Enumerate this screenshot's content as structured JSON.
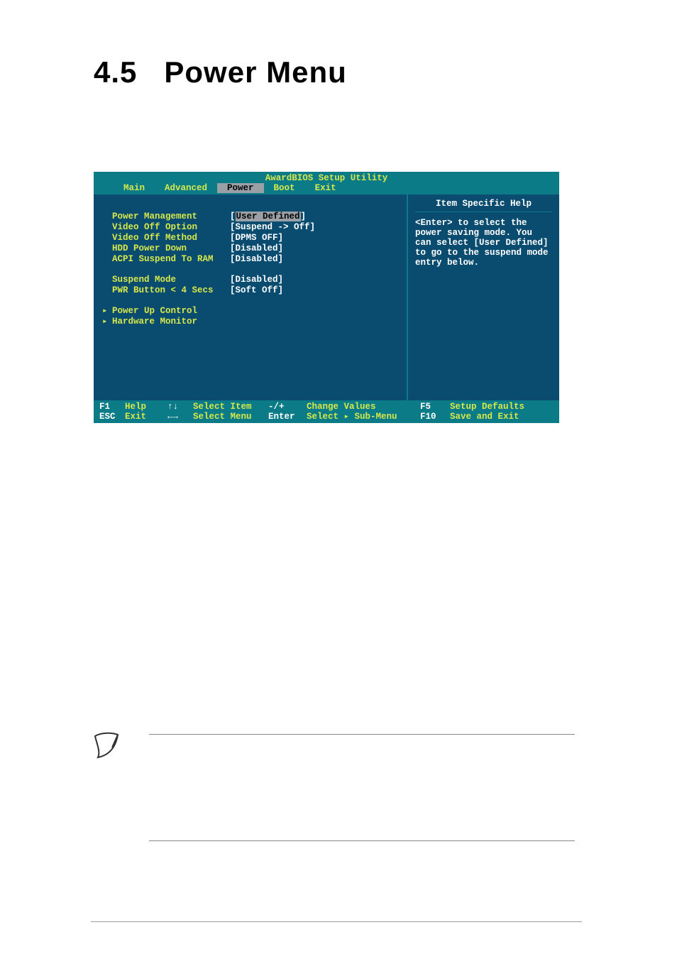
{
  "heading": {
    "number": "4.5",
    "title": "Power Menu"
  },
  "bios": {
    "title": "AwardBIOS Setup Utility",
    "tabs": {
      "main": "Main",
      "advanced": "Advanced",
      "power": "Power",
      "boot": "Boot",
      "exit": "Exit"
    },
    "settings": [
      {
        "label": "Power Management",
        "value": "User Defined",
        "selected": true
      },
      {
        "label": "Video Off Option",
        "value": "Suspend -> Off"
      },
      {
        "label": "Video Off Method",
        "value": "DPMS OFF"
      },
      {
        "label": "HDD Power Down",
        "value": "Disabled"
      },
      {
        "label": "ACPI Suspend To RAM",
        "value": "Disabled"
      }
    ],
    "settings2": [
      {
        "label": "Suspend Mode",
        "value": "Disabled"
      },
      {
        "label": "PWR Button < 4 Secs",
        "value": "Soft Off"
      }
    ],
    "submenus": [
      "Power Up Control",
      "Hardware Monitor"
    ],
    "help": {
      "title": "Item Specific Help",
      "body": "<Enter> to select the power saving mode. You can select [User Defined] to go to the suspend mode entry below."
    },
    "footer": {
      "r1": {
        "k1": "F1",
        "l1": "Help",
        "k2": "↑↓",
        "l2": "Select Item",
        "k3": "-/+",
        "l3": "Change Values",
        "k4": "F5",
        "l4": "Setup Defaults"
      },
      "r2": {
        "k1": "ESC",
        "l1": "Exit",
        "k2": "←→",
        "l2": "Select Menu",
        "k3": "Enter",
        "l3": "Select ▸ Sub-Menu",
        "k4": "F10",
        "l4": "Save and Exit"
      }
    }
  }
}
